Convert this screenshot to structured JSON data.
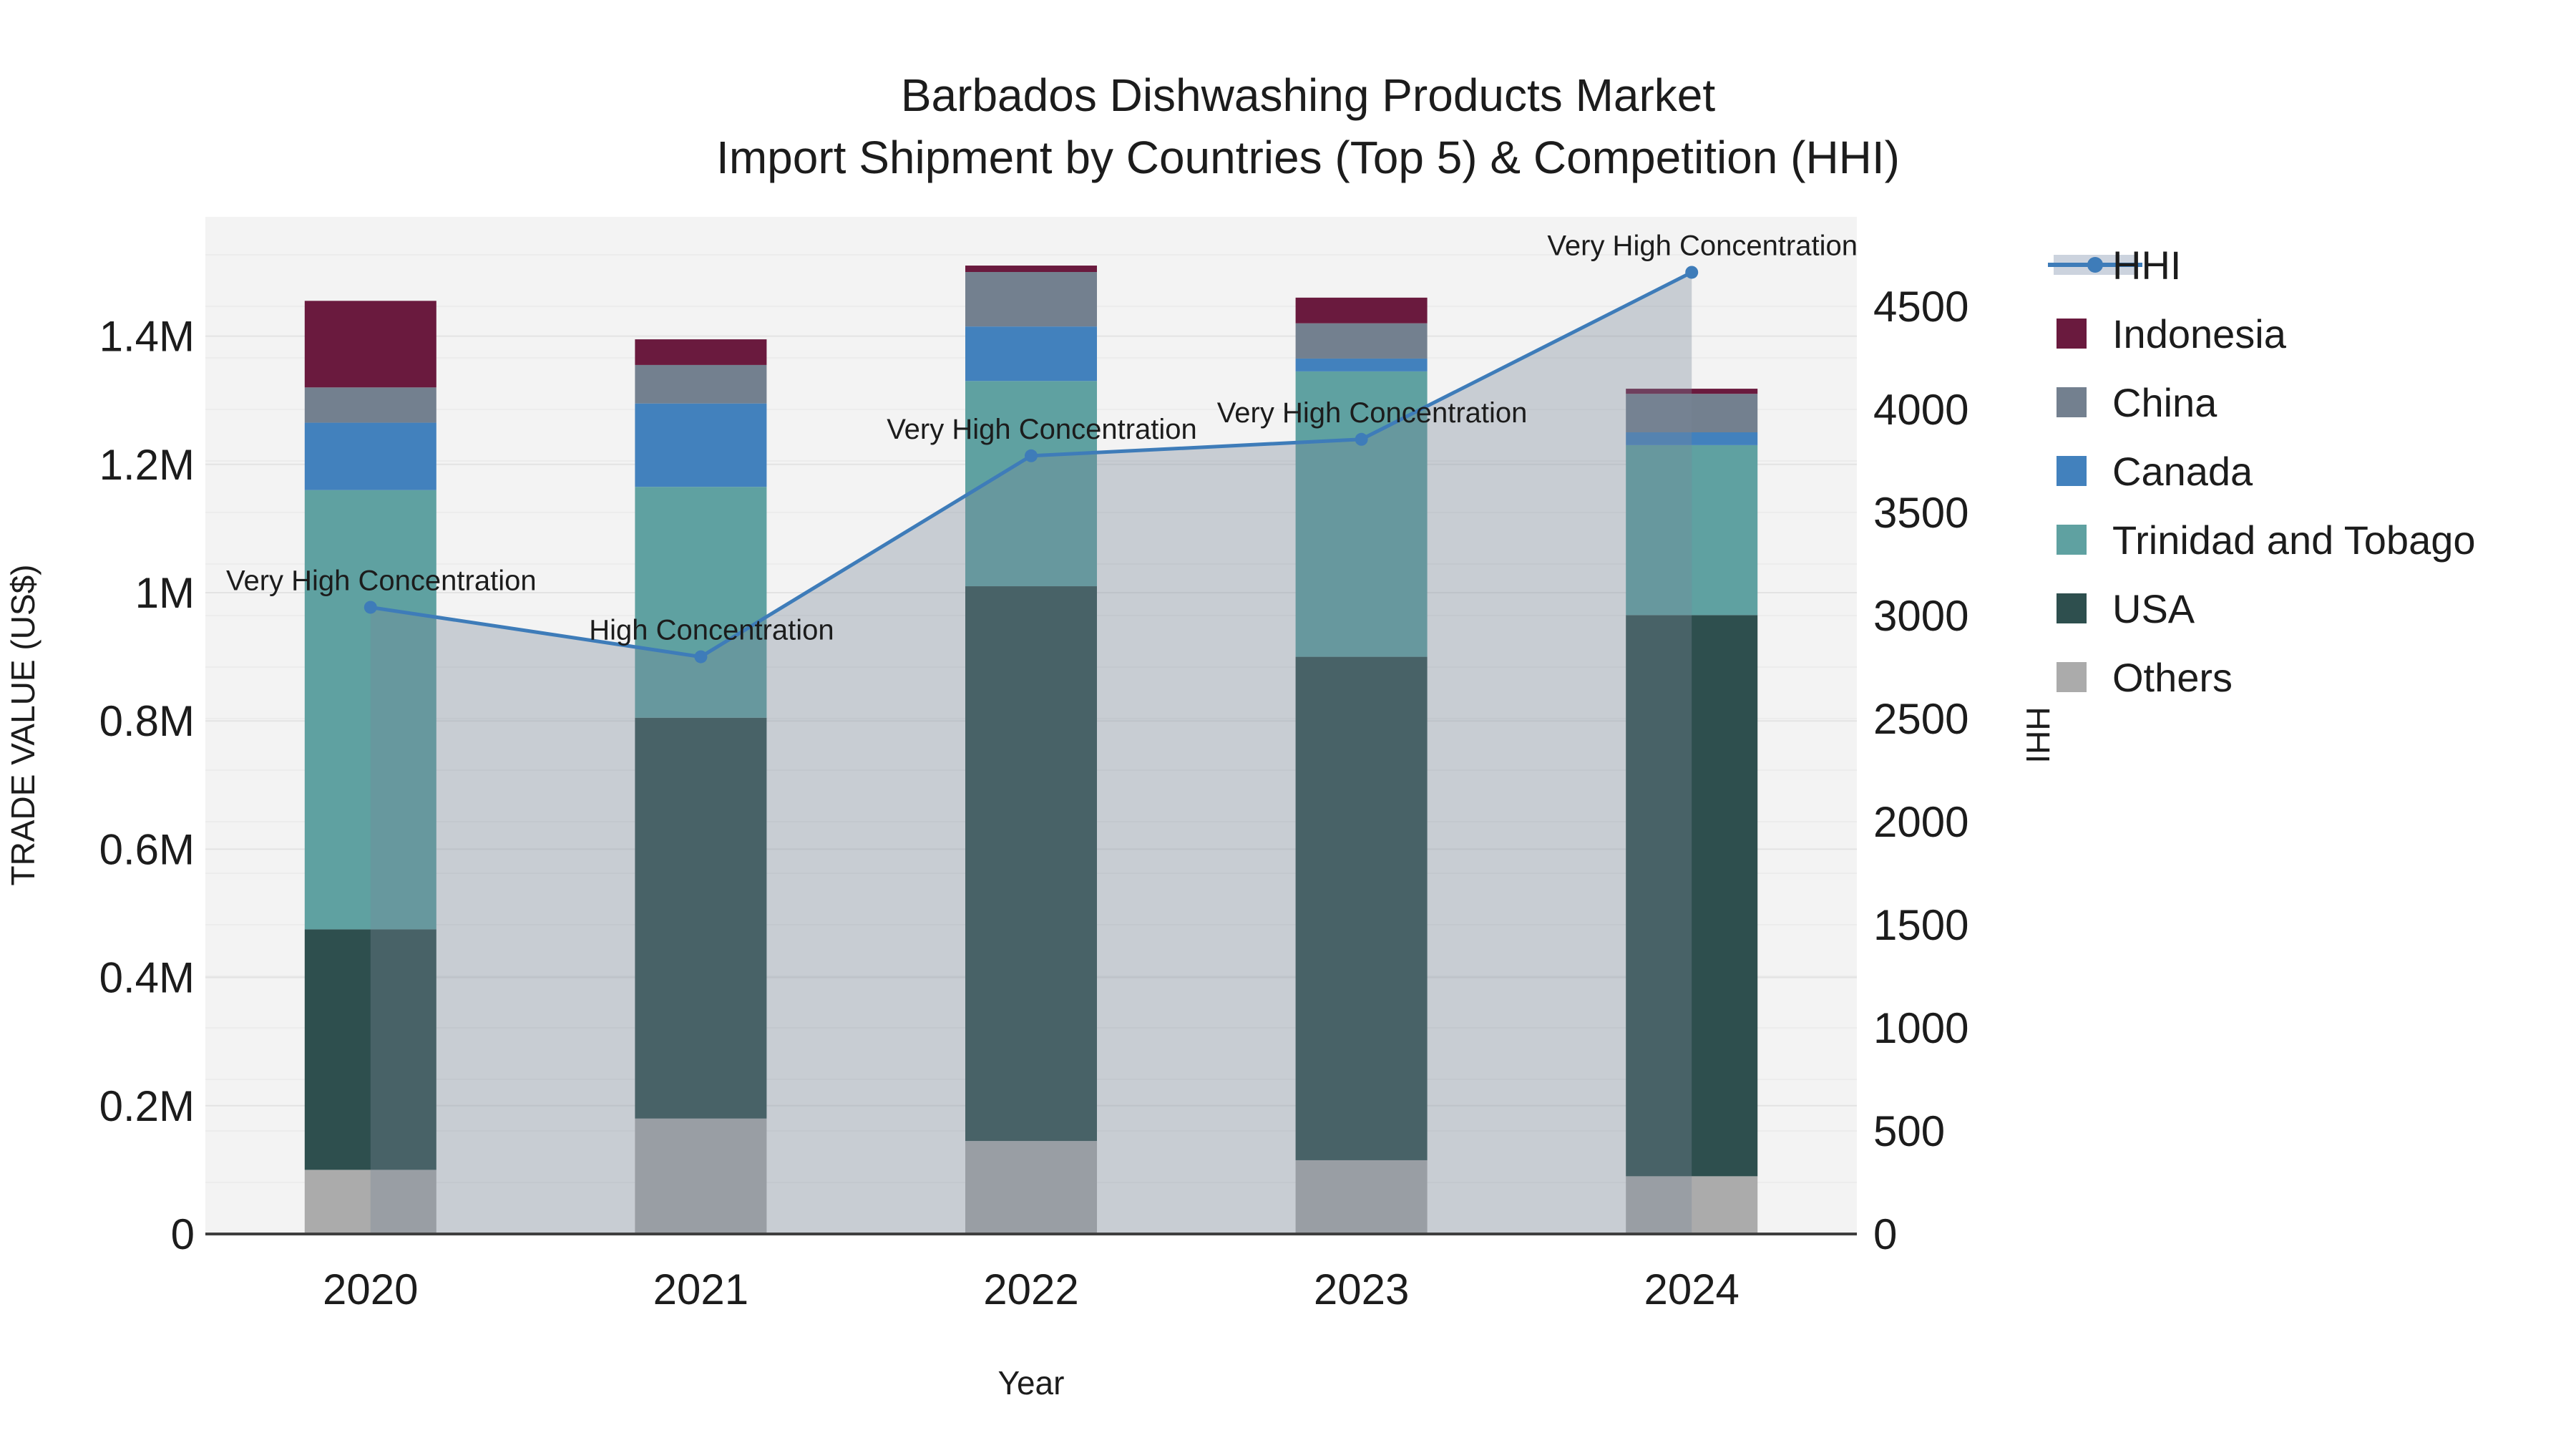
{
  "title": {
    "line1": "Barbados Dishwashing Products Market",
    "line2": "Import Shipment by Countries (Top 5) & Competition (HHI)"
  },
  "axes": {
    "x": {
      "title": "Year",
      "categories": [
        "2020",
        "2021",
        "2022",
        "2023",
        "2024"
      ]
    },
    "y_left": {
      "title": "TRADE VALUE (US$)",
      "ticks": [
        {
          "label": "0",
          "value": 0
        },
        {
          "label": "0.2M",
          "value": 0.2
        },
        {
          "label": "0.4M",
          "value": 0.4
        },
        {
          "label": "0.6M",
          "value": 0.6
        },
        {
          "label": "0.8M",
          "value": 0.8
        },
        {
          "label": "1M",
          "value": 1.0
        },
        {
          "label": "1.2M",
          "value": 1.2
        },
        {
          "label": "1.4M",
          "value": 1.4
        }
      ]
    },
    "y_right": {
      "title": "HHI",
      "ticks": [
        {
          "label": "0",
          "value": 0
        },
        {
          "label": "500",
          "value": 500
        },
        {
          "label": "1000",
          "value": 1000
        },
        {
          "label": "1500",
          "value": 1500
        },
        {
          "label": "2000",
          "value": 2000
        },
        {
          "label": "2500",
          "value": 2500
        },
        {
          "label": "3000",
          "value": 3000
        },
        {
          "label": "3500",
          "value": 3500
        },
        {
          "label": "4000",
          "value": 4000
        },
        {
          "label": "4500",
          "value": 4500
        }
      ]
    }
  },
  "legend": {
    "items": [
      {
        "label": "HHI",
        "type": "line",
        "color": "#3e7cb9"
      },
      {
        "label": "Indonesia",
        "type": "swatch",
        "color": "#6a1a3e"
      },
      {
        "label": "China",
        "type": "swatch",
        "color": "#73808f"
      },
      {
        "label": "Canada",
        "type": "swatch",
        "color": "#4281bd"
      },
      {
        "label": "Trinidad and Tobago",
        "type": "swatch",
        "color": "#5fa1a1"
      },
      {
        "label": "USA",
        "type": "swatch",
        "color": "#2e4f4e"
      },
      {
        "label": "Others",
        "type": "swatch",
        "color": "#ababab"
      }
    ]
  },
  "chart_data": {
    "type": "bar+line",
    "bar_mode": "stacked",
    "bar_unit": "Million US$",
    "categories": [
      "2020",
      "2021",
      "2022",
      "2023",
      "2024"
    ],
    "series": [
      {
        "name": "Others",
        "color": "#ababab",
        "values": [
          0.1,
          0.18,
          0.145,
          0.115,
          0.09
        ]
      },
      {
        "name": "USA",
        "color": "#2e4f4e",
        "values": [
          0.375,
          0.625,
          0.865,
          0.785,
          0.875
        ]
      },
      {
        "name": "Trinidad and Tobago",
        "color": "#5fa1a1",
        "values": [
          0.685,
          0.36,
          0.32,
          0.445,
          0.265
        ]
      },
      {
        "name": "Canada",
        "color": "#4281bd",
        "values": [
          0.105,
          0.13,
          0.085,
          0.02,
          0.02
        ]
      },
      {
        "name": "China",
        "color": "#73808f",
        "values": [
          0.055,
          0.06,
          0.085,
          0.055,
          0.06
        ]
      },
      {
        "name": "Indonesia",
        "color": "#6a1a3e",
        "values": [
          0.135,
          0.04,
          0.01,
          0.04,
          0.008
        ]
      }
    ],
    "bar_totals": [
      1.455,
      1.395,
      1.51,
      1.46,
      1.318
    ],
    "hhi": {
      "name": "HHI",
      "color": "#3e7cb9",
      "area_color": "rgba(119,136,153,0.35)",
      "values": [
        3040,
        2800,
        3775,
        3855,
        4665
      ]
    },
    "annotations": [
      "Very High Concentration",
      "High Concentration",
      "Very High Concentration",
      "Very High Concentration",
      "Very High Concentration"
    ],
    "ylim_left": [
      0,
      1.59
    ],
    "ylim_right": [
      0,
      4930
    ],
    "grid": {
      "left_step_M": 0.2,
      "right_step_HHI": 250,
      "orientation": "horizontal"
    },
    "legend_position": "right"
  }
}
